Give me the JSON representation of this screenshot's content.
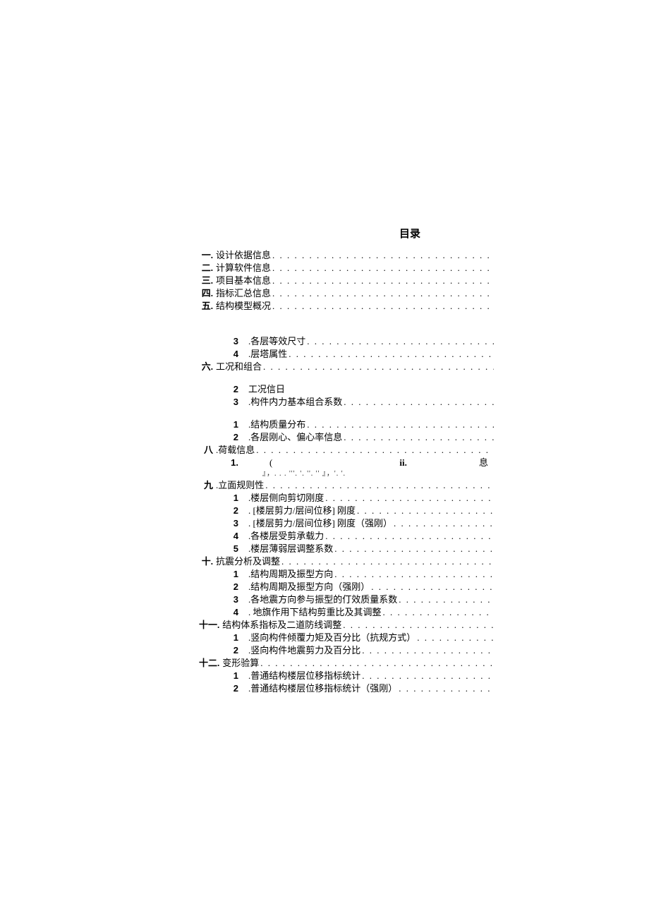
{
  "title": "目录",
  "sec1": {
    "num": "一.",
    "label": "设计依据信息"
  },
  "sec2": {
    "num": "二.",
    "label": "计算软件信息"
  },
  "sec3": {
    "num": "三.",
    "label": "项目基本信息"
  },
  "sec4": {
    "num": "四.",
    "label": "指标汇总信息"
  },
  "sec5": {
    "num": "五.",
    "label": "结构模型概况"
  },
  "sub5_3": {
    "num": "3",
    "label": ".各层等效尺寸"
  },
  "sub5_4": {
    "num": "4",
    "label": ".层塔属性"
  },
  "sec6": {
    "num": "六.",
    "label": "工况和组合"
  },
  "sub6_2": {
    "num": "2",
    "label": "工况信日"
  },
  "sub6_3": {
    "num": "3",
    "label": ".构件内力基本组合系数"
  },
  "sub7_1": {
    "num": "1",
    "label": ".结构质量分布"
  },
  "sub7_2": {
    "num": "2",
    "label": ".各层刚心、偏心率信息"
  },
  "sec8": {
    "num": "八",
    "label": ".荷载信息"
  },
  "sub8_1": {
    "num": "1.",
    "paren": "(",
    "ii": "ii.",
    "xi": "息"
  },
  "frag8": "』，. . . '''. '. ''. '' 』，'. '.",
  "sec9": {
    "num": "九",
    "label": ".立面规则性"
  },
  "sub9_1": {
    "num": "1",
    "label": ".楼层侧向剪切刚度"
  },
  "sub9_2": {
    "num": "2",
    "label": ". [楼层剪力/层间位移] 刚度"
  },
  "sub9_3": {
    "num": "3",
    "label": ". [楼层剪力/层间位移] 刚度（强刚）"
  },
  "sub9_4": {
    "num": "4",
    "label": ".各楼层受剪承载力"
  },
  "sub9_5": {
    "num": "5",
    "label": ".楼层薄弱层调整系数"
  },
  "sec10": {
    "num": "十.",
    "label": "抗震分析及调整"
  },
  "sub10_1": {
    "num": "1",
    "label": ".结构周期及振型方向"
  },
  "sub10_2": {
    "num": "2",
    "label": ".结构周期及振型方向（强刚）"
  },
  "sub10_3": {
    "num": "3",
    "label": ".各地震方向参与振型的仃效质量系数"
  },
  "sub10_4": {
    "num": "4",
    "label": ". 地旗作用下结构剪重比及其调整"
  },
  "sec11": {
    "num": "十一.",
    "label": "结构体系指标及二道防线调整"
  },
  "sub11_1": {
    "num": "1",
    "label": ".竖向构件倾覆力矩及百分比（抗规方式）"
  },
  "sub11_2": {
    "num": "2",
    "label": ".竖向构件地震剪力及百分比"
  },
  "sec12": {
    "num": "十二.",
    "label": "变形验算"
  },
  "sub12_1": {
    "num": "1",
    "label": ".普通结构楼层位移指标统计"
  },
  "sub12_2": {
    "num": "2",
    "label": ".普通结构楼层位移指标统计（强刚）"
  }
}
